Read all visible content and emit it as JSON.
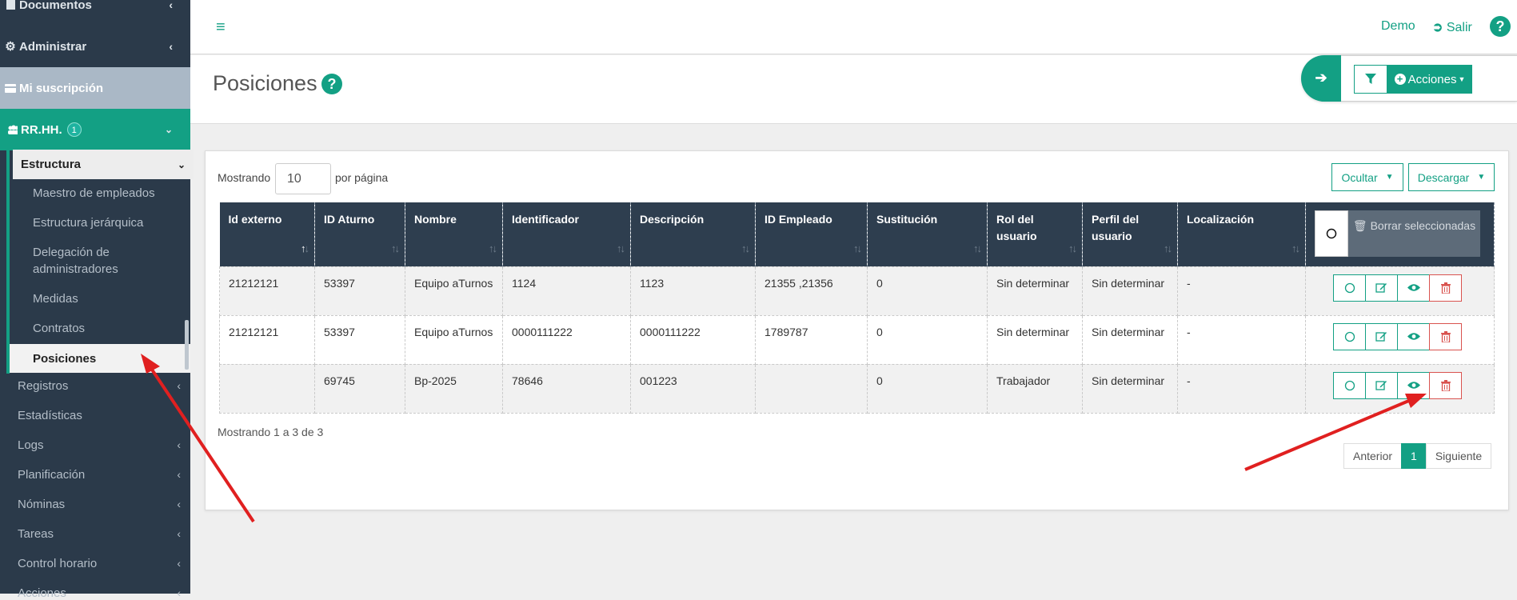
{
  "sidebar": {
    "documentos": "Documentos",
    "administrar": "Administrar",
    "suscripcion": "Mi suscripción",
    "rrhh": "RR.HH.",
    "rrhh_badge": "1",
    "estructura": "Estructura",
    "sub_items": [
      "Maestro de empleados",
      "Estructura jerárquica",
      "Delegación de",
      "administradores",
      "Medidas",
      "Contratos"
    ],
    "posiciones": "Posiciones",
    "items": [
      "Registros",
      "Estadísticas",
      "Logs",
      "Planificación",
      "Nóminas",
      "Tareas",
      "Control horario",
      "Acciones"
    ]
  },
  "topbar": {
    "demo": "Demo",
    "salir": "Salir",
    "help": "?"
  },
  "page": {
    "title": "Posiciones",
    "help": "?",
    "acciones": "Acciones"
  },
  "controls": {
    "mostrando": "Mostrando",
    "per_page": "10",
    "por_pagina": "por página",
    "ocultar": "Ocultar",
    "descargar": "Descargar"
  },
  "table": {
    "headers": [
      "Id externo",
      "ID Aturno",
      "Nombre",
      "Identificador",
      "Descripción",
      "ID Empleado",
      "Sustitución",
      "Rol del usuario",
      "Perfil del usuario",
      "Localización"
    ],
    "borrar": "Borrar seleccionadas",
    "rows": [
      [
        "21212121",
        "53397",
        "Equipo aTurnos",
        "1124",
        "1123",
        "21355 ,21356",
        "0",
        "Sin determinar",
        "Sin determinar",
        "-"
      ],
      [
        "21212121",
        "53397",
        "Equipo aTurnos",
        "0000111222",
        "0000111222",
        "1789787",
        "0",
        "Sin determinar",
        "Sin determinar",
        "-"
      ],
      [
        "",
        "69745",
        "Bp-2025",
        "78646",
        "001223",
        "",
        "0",
        "Trabajador",
        "Sin determinar",
        "-"
      ]
    ]
  },
  "footer": {
    "showing": "Mostrando 1 a 3 de 3",
    "anterior": "Anterior",
    "page": "1",
    "siguiente": "Siguiente"
  },
  "colors": {
    "accent": "#13a084",
    "sidebar": "#2b3a4a",
    "table_header": "#2e3e4f",
    "danger": "#d9534f",
    "annotation": "#e02020"
  }
}
